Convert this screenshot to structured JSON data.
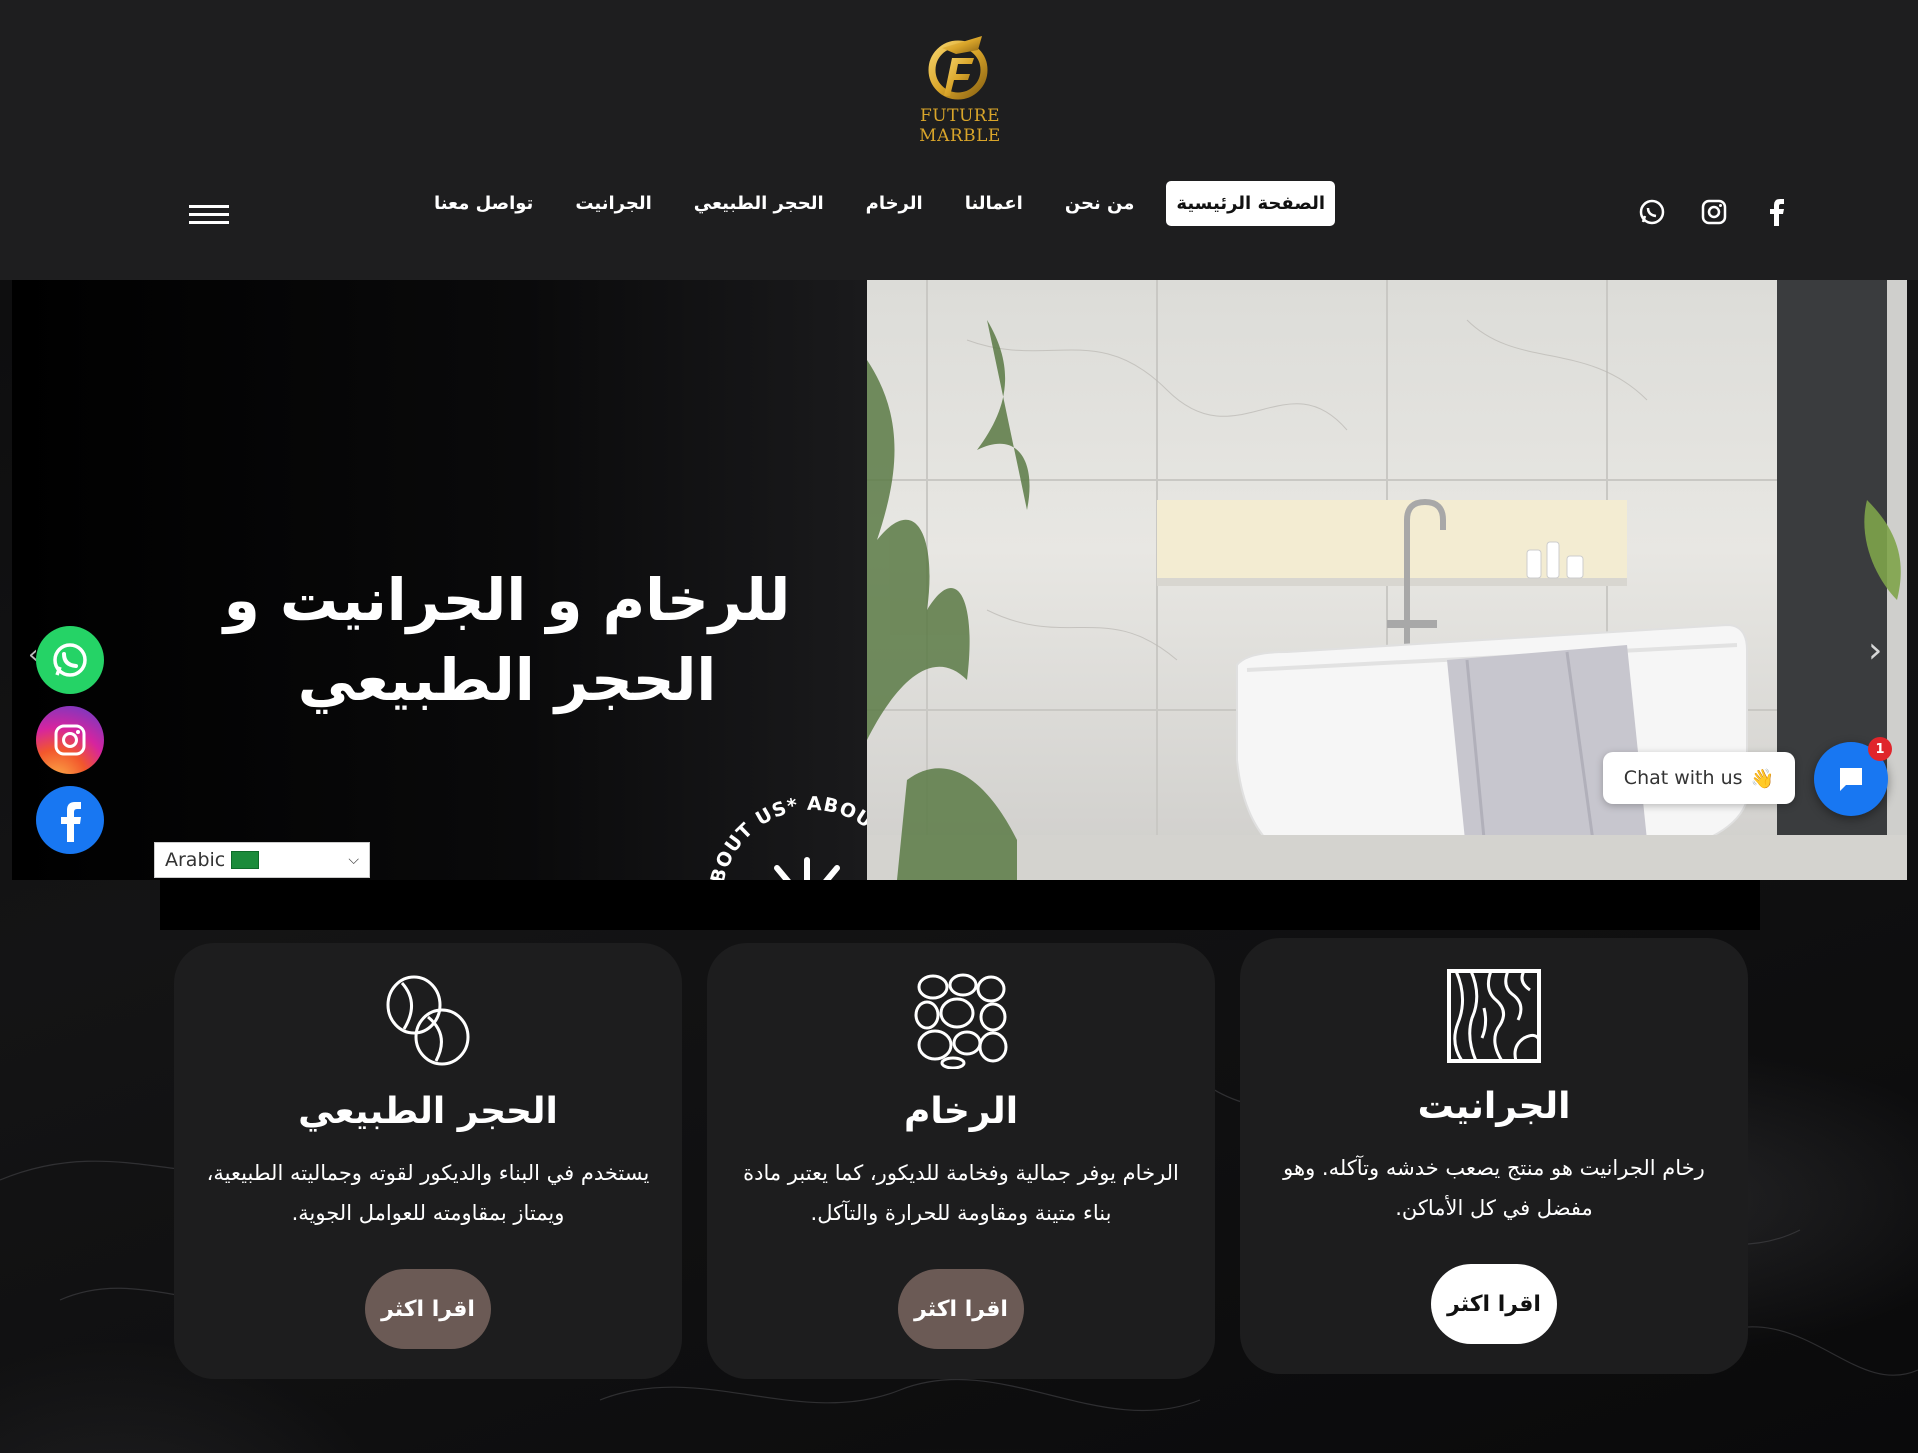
{
  "brand": {
    "name": "FUTURE MARBLE"
  },
  "nav": {
    "items": [
      {
        "label": "الصفحة الرئيسية",
        "active": true
      },
      {
        "label": "من نحن"
      },
      {
        "label": "اعمالنا"
      },
      {
        "label": "الرخام"
      },
      {
        "label": "الحجر الطبيعي"
      },
      {
        "label": "الجرانيت"
      },
      {
        "label": "تواصل معنا"
      }
    ]
  },
  "hero": {
    "title": "للرخام و الجرانيت و الحجر الطبيعي",
    "badge_text": "ABOUT US* ABOUT US* ABOUT US*"
  },
  "language": {
    "selected": "Arabic"
  },
  "chat": {
    "label": "Chat with us",
    "emoji": "👋",
    "badge": "1"
  },
  "cards": [
    {
      "title": "الحجر الطبيعي",
      "text": "يستخدم في البناء والديكور لقوته وجماليته الطبيعية، ويمتاز بمقاومته للعوامل الجوية.",
      "button": "اقرا اكثر",
      "icon": "coffee-beans-icon"
    },
    {
      "title": "الرخام",
      "text": "الرخام يوفر جمالية وفخامة للديكور، كما يعتبر مادة بناء متينة ومقاومة للحرارة والتآكل.",
      "button": "اقرا اكثر",
      "icon": "stones-icon"
    },
    {
      "title": "الجرانيت",
      "text": "رخام الجرانيت هو منتج يصعب خدشه وتآكله. وهو مفضل في كل الأماكن.",
      "button": "اقرا اكثر",
      "icon": "granite-pattern-icon"
    }
  ],
  "colors": {
    "background": "#1e1e1f",
    "gold": "#d9a52a",
    "card_bg": "#1d1d1e",
    "button_brown": "#6b5a55",
    "whatsapp": "#25d366",
    "facebook": "#1877f2"
  }
}
